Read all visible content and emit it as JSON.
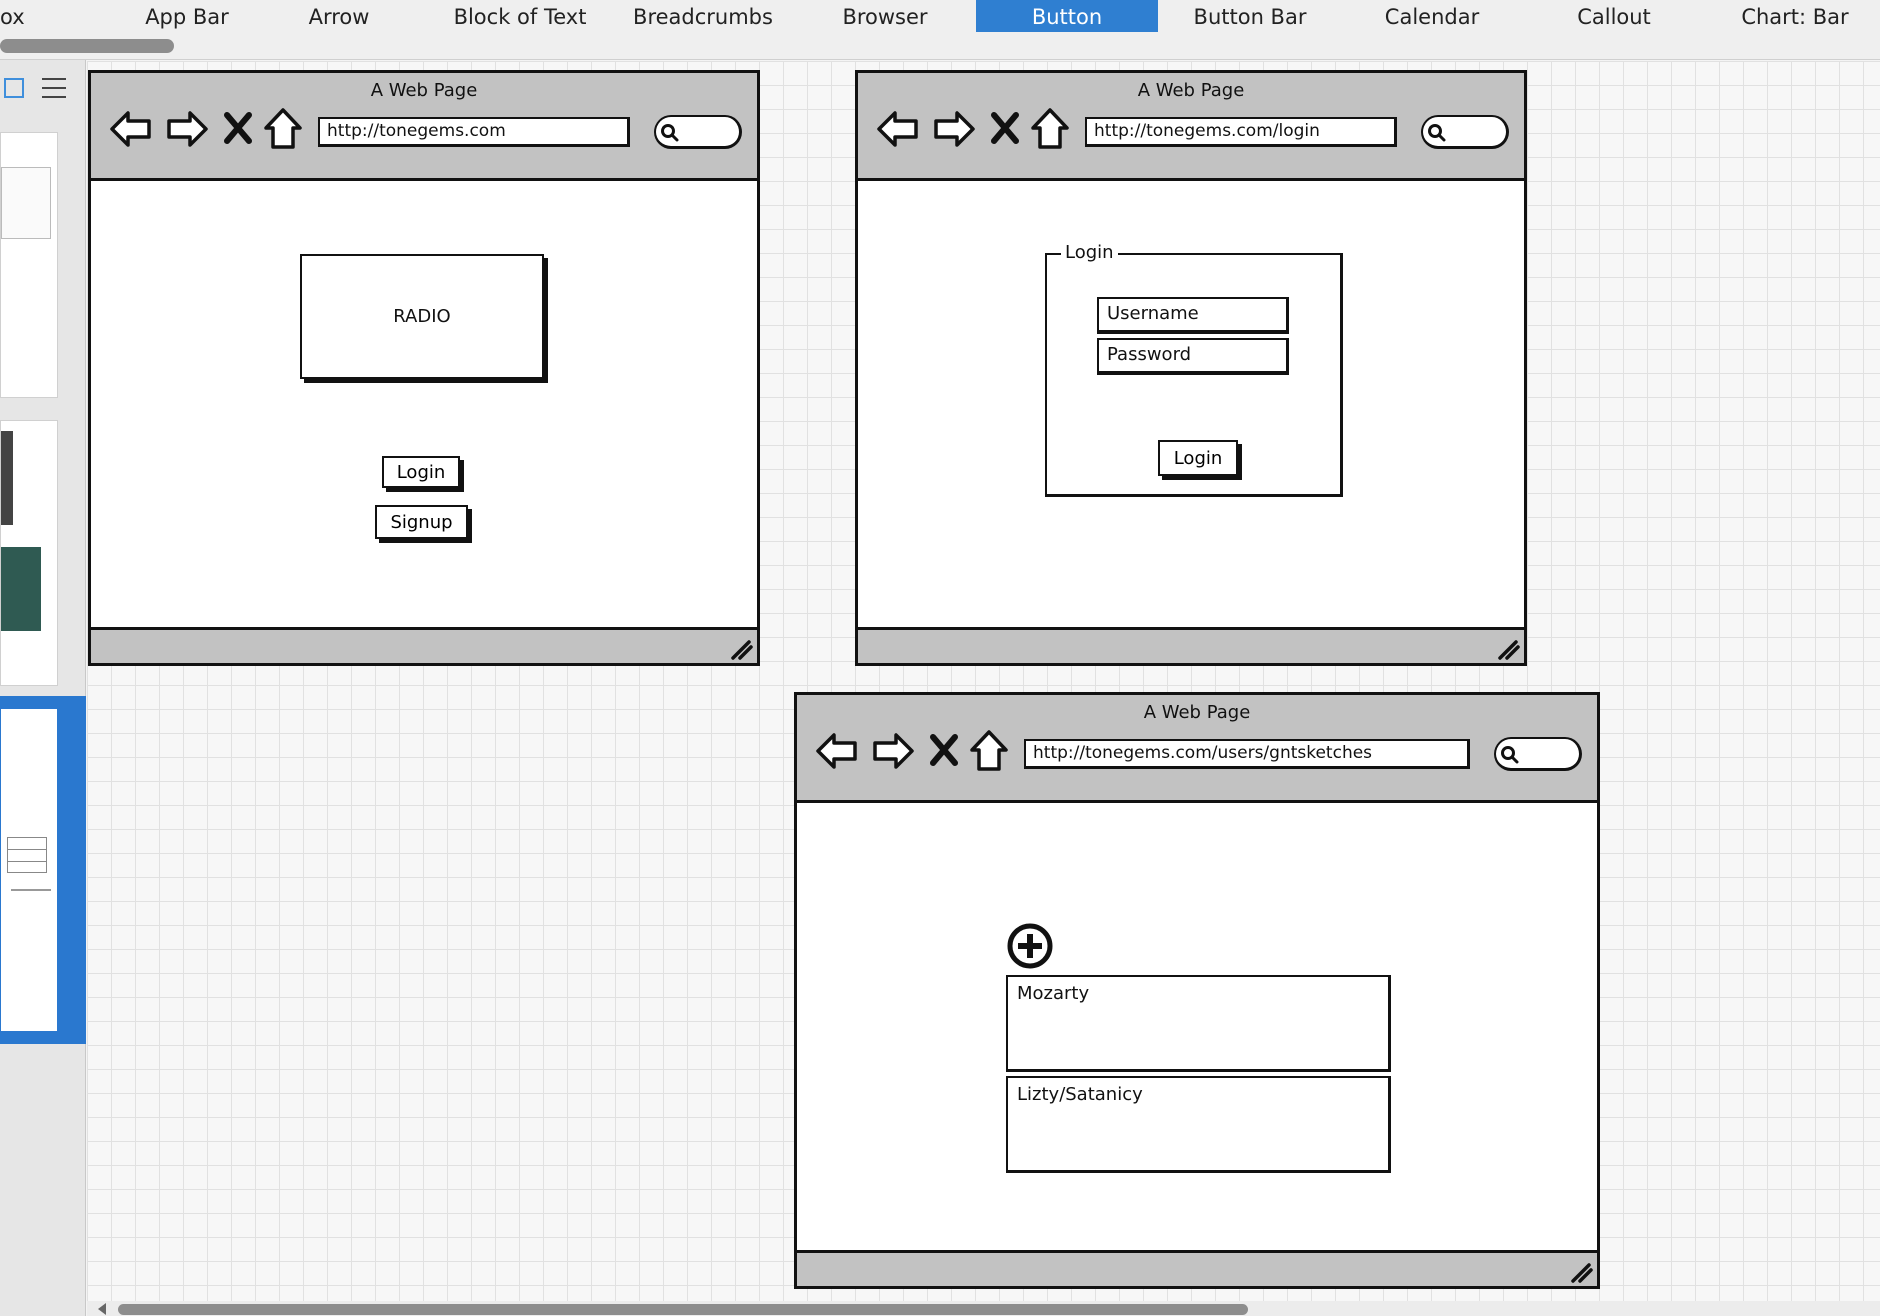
{
  "component_strip": {
    "items": [
      "ox",
      "App Bar",
      "Arrow",
      "Block of Text",
      "Breadcrumbs",
      "Browser",
      "Button",
      "Button Bar",
      "Calendar",
      "Callout",
      "Chart: Bar"
    ],
    "active": "Button",
    "active_color": "#2f7fd1"
  },
  "sidebar": {
    "view_icons": [
      "grid-view-icon",
      "list-view-icon"
    ],
    "selected_color": "#2a78cf"
  },
  "mockups": [
    {
      "title": "A Web Page",
      "url": "http://tonegems.com",
      "content": {
        "panel_label": "RADIO",
        "buttons": [
          "Login",
          "Signup"
        ]
      }
    },
    {
      "title": "A Web Page",
      "url": "http://tonegems.com/login",
      "content": {
        "fieldset_legend": "Login",
        "username_value": "Username",
        "password_value": "Password",
        "submit_label": "Login"
      }
    },
    {
      "title": "A Web Page",
      "url": "http://tonegems.com/users/gntsketches",
      "content": {
        "add_icon": "plus-circle-icon",
        "list_items": [
          "Mozarty",
          "Lizty/Satanicy"
        ]
      }
    }
  ],
  "browser_icons": [
    "back-arrow-icon",
    "forward-arrow-icon",
    "stop-icon",
    "home-icon",
    "search-icon",
    "resize-grip-icon"
  ]
}
